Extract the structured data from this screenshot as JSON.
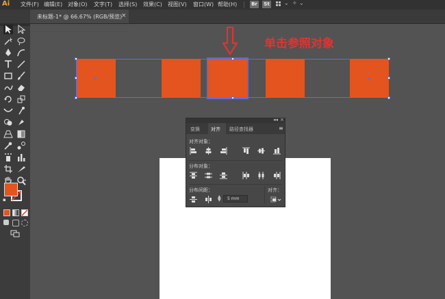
{
  "app": {
    "logo": "Ai"
  },
  "menubar": {
    "items": [
      "文件(F)",
      "编辑(E)",
      "对象(O)",
      "文字(T)",
      "选择(S)",
      "效果(C)",
      "视图(V)",
      "窗口(W)",
      "帮助(H)"
    ],
    "bridge_badge": "Br",
    "stock_badge": "St"
  },
  "document_tab": {
    "label": "未标题-1* @ 66.67% (RGB/预览)",
    "close": "×"
  },
  "canvas": {
    "annotation": "单击参照对象",
    "fill_color": "#e4541f",
    "selection_color": "#5d6fd6",
    "annotation_color": "#e4322f"
  },
  "align_panel": {
    "collapse": "◂◂",
    "close": "×",
    "menu": "≡",
    "tabs": [
      "变换",
      "对齐",
      "路径查找器"
    ],
    "active_tab": "对齐",
    "sections": {
      "align_objects": "对齐对象：",
      "distribute_objects": "分布对象：",
      "distribute_spacing": "分布间距：",
      "align_to": "对齐："
    },
    "spacing_value": "5 mm"
  },
  "toolbar": {
    "fill_color": "#e4541f",
    "stroke_color": "none"
  }
}
